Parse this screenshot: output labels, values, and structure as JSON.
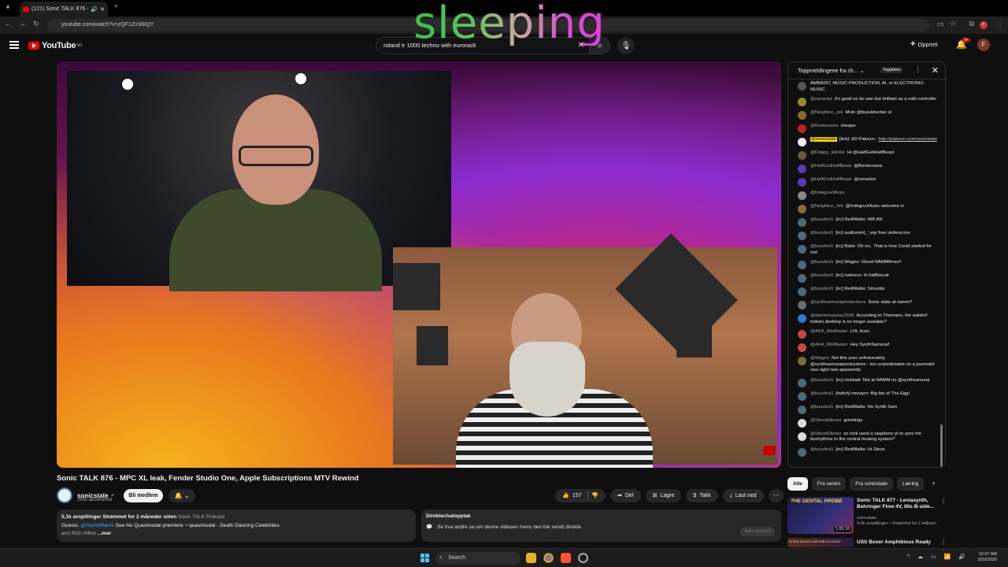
{
  "browser": {
    "tab_title": "(121) Sonic TALK 876 - MPC",
    "new_tab": "+",
    "url": "youtube.com/watch?v=zQF1ZxS6IQY"
  },
  "overlay_text": "sleeping",
  "youtube": {
    "logo": "YouTube",
    "region": "NO",
    "search_value": "roland tr 1000 techno with eurorack",
    "create_label": "Opprett",
    "notif_count": "9+",
    "avatar_letter": "F"
  },
  "video": {
    "title": "Sonic TALK 876 - MPC XL leak, Fender Studio One, Apple Subscriptions MTV Rewind",
    "channel": "sonicstate",
    "subscribers": "260k abonnenter",
    "member_button": "Bli medlem",
    "likes": "157",
    "share": "Del",
    "save": "Lagre",
    "thanks": "Takk",
    "download": "Last ned",
    "more": "⋯"
  },
  "description": {
    "stats": "5,1k avspillinger  Strømmet for 2 måneder siden",
    "podcast": "Sonic TALK Podcast",
    "line2_prefix": "Guests:",
    "guest1": "@GazWilliams",
    "line2_mid": "See his Quasimodal premiere:",
    "line2_link": "• quasimodal - Death Dancing Celebrities",
    "line3": "and Rich Hilton",
    "more": "...mer"
  },
  "live_replay": {
    "heading": "Direktechatopptak",
    "body": "Se hva andre sa om denne videoen mens den ble sendt direkte.",
    "button": "Åpne panelet"
  },
  "chat": {
    "header": "Toppmeldingene fra ch...",
    "topfans": "Toppfans",
    "messages": [
      {
        "author": "",
        "text": "AMBIENT, MUSIC-PRODUCTION, AI, or ELECTRONIC-MUSIC",
        "color": "#555"
      },
      {
        "author": "@zenartist",
        "text": "It's good on its own but brilliant as a midi controller",
        "color": "#9a8a2a"
      },
      {
        "author": "@Neighbor_Jek",
        "text": "Moin @buyukberber o/",
        "color": "#8a6a2a"
      },
      {
        "author": "@Bonkorama",
        "text": "cheapo",
        "color": "#b22"
      },
      {
        "author": "@sonicstate",
        "text": "[link]: AD:Patreon : ",
        "link": "http://patreon.com/sonicstate",
        "owner": true,
        "color": "#eef"
      },
      {
        "author": "@Floppy_Winkle",
        "text": "Hi @HalfGodHalfBeast",
        "color": "#6a5a3a"
      },
      {
        "author": "@HalfGodHalfBeast",
        "text": "@Bonkorama",
        "color": "#5a3ab8"
      },
      {
        "author": "@HalfGodHalfBeast",
        "text": "@zenartist",
        "color": "#5a3ab8"
      },
      {
        "author": "@IndegruvMusic",
        "text": "",
        "color": "#888"
      },
      {
        "author": "@Neighbor_Jek",
        "text": "@IndegruvMusic welcome in",
        "color": "#8a6a2a"
      },
      {
        "author": "@buzzbot1",
        "text": "[irc] RedWalks: WB AN",
        "color": "#4a6a7a"
      },
      {
        "author": "@buzzbot1",
        "text": "[irc] audionerd_: yay free underscore",
        "color": "#4a6a7a"
      },
      {
        "author": "@buzzbot1",
        "text": "[irc] Babz: Oh no.. That is how Covid started for me!",
        "color": "#4a6a7a"
      },
      {
        "author": "@buzzbot1",
        "text": "[irc] Wagoo: Ghost NAMMthrax!!",
        "color": "#4a6a7a"
      },
      {
        "author": "@buzzbot1",
        "text": "[irc] nativevs: hi halfbiscuit",
        "color": "#4a6a7a"
      },
      {
        "author": "@buzzbot1",
        "text": "[irc] RedWalks: Sinusitis",
        "color": "#4a6a7a"
      },
      {
        "author": "@synthsamuraiproductions",
        "text": "Sonic state at namm?",
        "color": "#6a6a6a"
      },
      {
        "author": "@darrenmackay2536",
        "text": "According to Thomann, the waldorf iridium desktop is no longer avaiable?",
        "color": "#2a7ad8"
      },
      {
        "author": "@AKA_MixMaster",
        "text": "LOL buzz.",
        "color": "#c44"
      },
      {
        "author": "@AKA_MixMaster",
        "text": "Hey SynthSamurai!",
        "color": "#c44"
      },
      {
        "author": "@Wagoo",
        "text": "Not this year unfortunately @synthsamuraiproductions - too unpredictable on a journalist visa right now apparently",
        "color": "#7a6a3a"
      },
      {
        "author": "@buzzbot1",
        "text": "[irc] nickbatt: Not at NAMM no @synthsamurai",
        "color": "#4a6a7a"
      },
      {
        "author": "@buzzbot1",
        "text": "[twitch] morayrn: Big fan of The Egg!",
        "color": "#4a6a7a"
      },
      {
        "author": "@buzzbot1",
        "text": "[irc] RedWalks: No Synth Sam",
        "color": "#4a6a7a"
      },
      {
        "author": "@SteveElbows",
        "text": "greetings",
        "color": "#ddd"
      },
      {
        "author": "@SteveElbows",
        "text": "so nick used a raspberry pi to sync his biorhythms to the central heating system?",
        "color": "#ddd"
      },
      {
        "author": "@buzzbot1",
        "text": "[irc] RedWalks: Hi Steve",
        "color": "#4a6a7a"
      }
    ]
  },
  "chips": [
    "Alle",
    "Fra serien",
    "Fra sonicstate",
    "Læring"
  ],
  "recommendations": [
    {
      "thumb_text": "THE DENTAL PROBE",
      "duration": "1:05:10",
      "title": "Sonic TALK 877 - Leviasynth, Behringer Flow 4V, 80s B-side...",
      "channel": "sonicstate",
      "meta": "4,5k avspillinger • Strømmet for 2 måned..."
    },
    {
      "thumb_text": "SLEEK BOXER AMPHIBIOUS BOAT",
      "title": "USS Boxer Amphibious Ready"
    }
  ],
  "taskbar": {
    "search": "Search",
    "time": "12:07 AM",
    "date": "3/23/2026"
  },
  "colors": {
    "youtube_red": "#ff0000",
    "link_blue": "#3ea6ff",
    "owner_badge": "#ffd600"
  }
}
